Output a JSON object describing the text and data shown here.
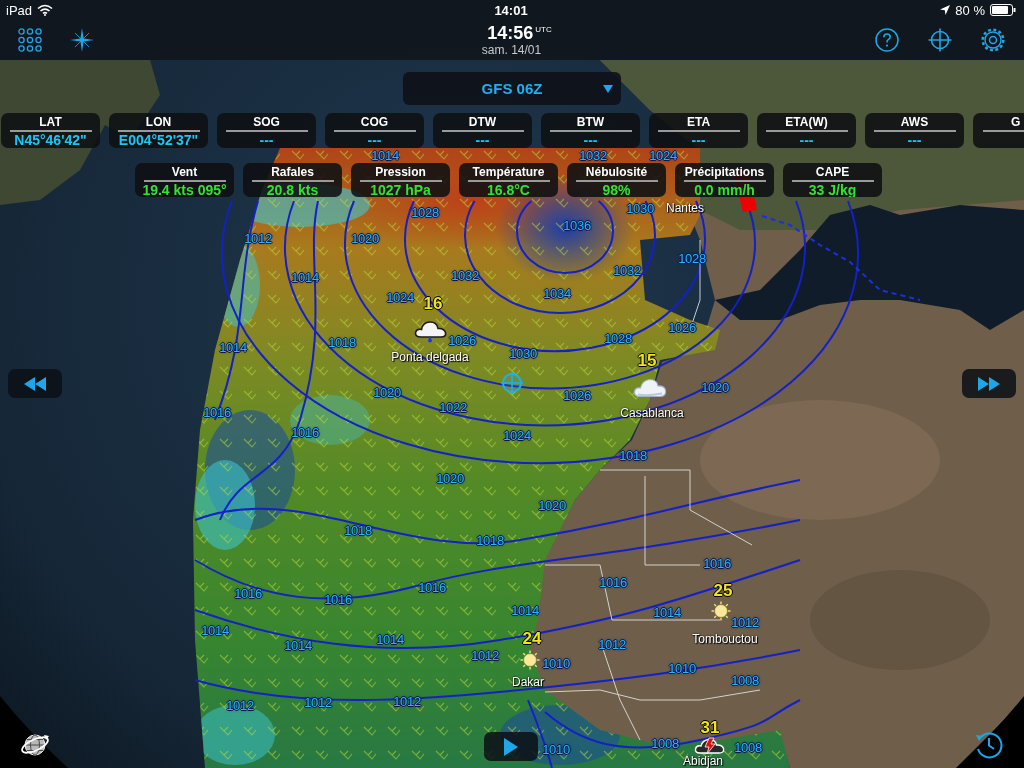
{
  "status_bar": {
    "device": "iPad",
    "time": "14:01",
    "battery": "80 %"
  },
  "toolbar": {
    "time": "14:56",
    "time_zone": "UTC",
    "date": "sam. 14/01"
  },
  "model_selector": {
    "label": "GFS 06Z"
  },
  "navigation_readouts": [
    {
      "label": "LAT",
      "value": "N45°46'42\""
    },
    {
      "label": "LON",
      "value": "E004°52'37\""
    },
    {
      "label": "SOG",
      "value": "---"
    },
    {
      "label": "COG",
      "value": "---"
    },
    {
      "label": "DTW",
      "value": "---"
    },
    {
      "label": "BTW",
      "value": "---"
    },
    {
      "label": "ETA",
      "value": "---"
    },
    {
      "label": "ETA(W)",
      "value": "---"
    },
    {
      "label": "AWS",
      "value": "---"
    },
    {
      "label": "G"
    }
  ],
  "weather_readouts": [
    {
      "label": "Vent",
      "value": "19.4 kts 095°"
    },
    {
      "label": "Rafales",
      "value": "20.8 kts"
    },
    {
      "label": "Pression",
      "value": "1027 hPa"
    },
    {
      "label": "Température",
      "value": "16.8°C"
    },
    {
      "label": "Nébulosité",
      "value": "98%"
    },
    {
      "label": "Précipitations",
      "value": "0.0 mm/h"
    },
    {
      "label": "CAPE",
      "value": "33 J/kg"
    }
  ],
  "map": {
    "isobar_labels": [
      "1014",
      "1032",
      "1024",
      "1028",
      "1030",
      "1036",
      "1012",
      "1020",
      "1028",
      "1014",
      "1032",
      "1032",
      "1024",
      "1034",
      "1026",
      "1014",
      "1018",
      "1026",
      "1028",
      "1030",
      "1020",
      "1026",
      "1020",
      "1016",
      "1022",
      "1016",
      "1024",
      "1018",
      "1020",
      "1020",
      "1018",
      "1018",
      "1016",
      "1016",
      "1016",
      "1016",
      "1016",
      "1014",
      "1014",
      "1012",
      "1014",
      "1014",
      "1014",
      "1012",
      "1012",
      "1010",
      "1010",
      "1008",
      "1012",
      "1012",
      "1012",
      "1010",
      "1008",
      "1008"
    ],
    "cities": [
      {
        "name": "Ponta delgada",
        "temperature": "16",
        "kind": "rain"
      },
      {
        "name": "Nantes"
      },
      {
        "name": "Casablanca",
        "temperature": "15",
        "kind": "cloudy"
      },
      {
        "name": "Dakar",
        "temperature": "24",
        "kind": "sunny"
      },
      {
        "name": "Tombouctou",
        "temperature": "25",
        "kind": "sunny"
      },
      {
        "name": "Abidjan",
        "temperature": "31",
        "kind": "storm"
      }
    ]
  }
}
